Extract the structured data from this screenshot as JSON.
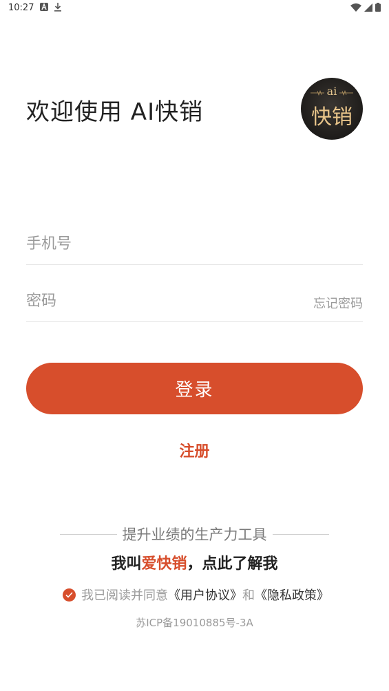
{
  "status_bar": {
    "time": "10:27"
  },
  "header": {
    "welcome": "欢迎使用 AI快销"
  },
  "logo": {
    "small_text": "ai",
    "main_text": "快销"
  },
  "form": {
    "phone_placeholder": "手机号",
    "password_placeholder": "密码",
    "forgot_password": "忘记密码"
  },
  "actions": {
    "login_label": "登录",
    "register_label": "注册"
  },
  "footer": {
    "slogan": "提升业绩的生产力工具",
    "intro_prefix": "我叫",
    "intro_highlight": "爱快销",
    "intro_suffix": "，点此了解我",
    "agreement_prefix": "我已阅读并同意",
    "user_agreement": "《用户协议》",
    "and": "和",
    "privacy_policy": "《隐私政策》",
    "agreement_checked": true,
    "icp": "苏ICP备19010885号-3A"
  },
  "colors": {
    "accent": "#d74e2c",
    "placeholder": "#9a9a9a",
    "text": "#222222"
  }
}
